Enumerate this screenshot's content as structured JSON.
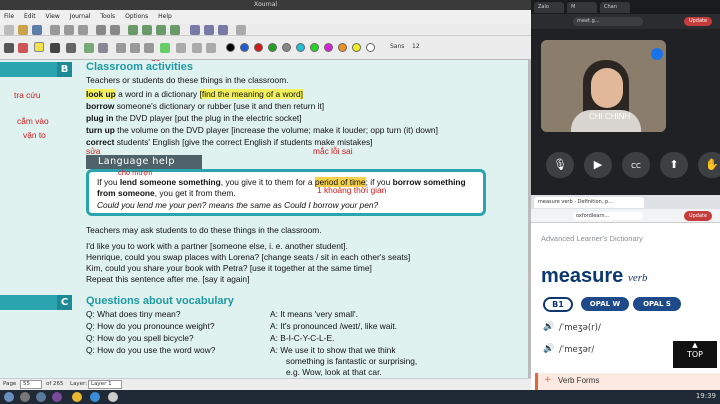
{
  "xournal": {
    "title": "Xournal",
    "menu": [
      "File",
      "Edit",
      "View",
      "Journal",
      "Tools",
      "Options",
      "Help"
    ],
    "font_label": "Sans",
    "font_size": "12",
    "pen_colors": [
      "#000000",
      "#1a5fd1",
      "#d11a1a",
      "#22a022",
      "#888888",
      "#22c0d8",
      "#22d822",
      "#d822d8",
      "#f09020",
      "#f0f020",
      "#ffffff"
    ],
    "status": {
      "page_label": "Page",
      "page_value": "55",
      "page_total": "of 265",
      "layer_label": "Layer:",
      "layer_value": "Layer 1"
    }
  },
  "doc": {
    "section_b": {
      "letter": "B",
      "title": "Classroom activities",
      "intro": "Teachers or students do these things in the classroom.",
      "items": [
        {
          "term": "look up",
          "rest": " a word in a dictionary ",
          "note": "[find the meaning of a word]"
        },
        {
          "term": "borrow",
          "rest": " someone's dictionary or rubber ",
          "note": "[use it and then return it]"
        },
        {
          "term": "plug in",
          "rest": " the DVD player ",
          "note": "[put the plug in the electric socket]"
        },
        {
          "term": "turn up",
          "rest": " the volume on the DVD player ",
          "note": "[increase the volume; make it louder; opp turn (it) down]"
        },
        {
          "term": "correct",
          "rest": " students' English ",
          "note": "[give the correct English if students make mistakes]"
        }
      ],
      "handwritten": {
        "do": "do",
        "tra_cuu": "tra cứu",
        "cam_vao": "cắm vào",
        "van_to": "vặn to",
        "sua": "sửa",
        "mac_loi_sai": "mắc lỗi sai",
        "cho_muon": "cho mượn",
        "khoang_thoi_gian": "1 khoảng thời gian"
      },
      "lang_help_label": "Language  help",
      "lang_help_line1a": "If you ",
      "lang_help_line1b": "lend someone something",
      "lang_help_line1c": ", you give it to them for a ",
      "lang_help_line1d": "period of time",
      "lang_help_line1e": "; if you ",
      "lang_help_line1f": "borrow something",
      "lang_help_line2a": "from someone",
      "lang_help_line2b": ", you get it from them.",
      "lang_help_line3": "Could you lend me your pen? means the same as Could I borrow your pen?",
      "after": "Teachers may ask students to do these things in the classroom.",
      "examples": [
        "I'd like you to work with a partner [someone else, i. e. another student].",
        "Henrique, could you swap places with Lorena? [change seats / sit in each other's seats]",
        "Kim, could you share your book with Petra? [use it together at the same time]",
        "Repeat this sentence after me. [say it again]"
      ]
    },
    "section_c": {
      "letter": "C",
      "title": "Questions about vocabulary",
      "qa": [
        {
          "q": "Q:   What does tiny mean?",
          "a": "A:   It means 'very small'."
        },
        {
          "q": "Q:   How do you pronounce weight?",
          "a": "A:   It's pronounced /weɪt/, like wait."
        },
        {
          "q": "Q:   How do you spell bicycle?",
          "a": "A:   B-I-C-Y-C-L-E."
        },
        {
          "q": "Q:   How do you use the word wow?",
          "a": "A:   We use it to show that we think"
        }
      ],
      "a_cont1": "something is fantastic or surprising,",
      "a_cont2": "e.g. Wow, look at that car."
    }
  },
  "meet": {
    "tabs": [
      "Zalo",
      "M",
      "Chan"
    ],
    "url": "meet.g...",
    "update_label": "Update",
    "participant_name": "CHI CHINH",
    "controls": [
      "mic-button",
      "camera-button",
      "captions-button",
      "present-button",
      "raise-hand-button"
    ]
  },
  "dictionary": {
    "tab_title": "measure verb - Definition, p...",
    "url": "oxfordlearn...",
    "update_label": "Update",
    "brand": "Advanced Learner's Dictionary",
    "headword": "measure",
    "pos": "verb",
    "level": "B1",
    "tags": [
      "OPAL W",
      "OPAL S"
    ],
    "pron_br": "/ˈmeʒə(r)/",
    "pron_us": "/ˈmeʒər/",
    "top_label": "TOP",
    "verb_forms": "Verb Forms"
  },
  "taskbar": {
    "time": "19:39"
  }
}
